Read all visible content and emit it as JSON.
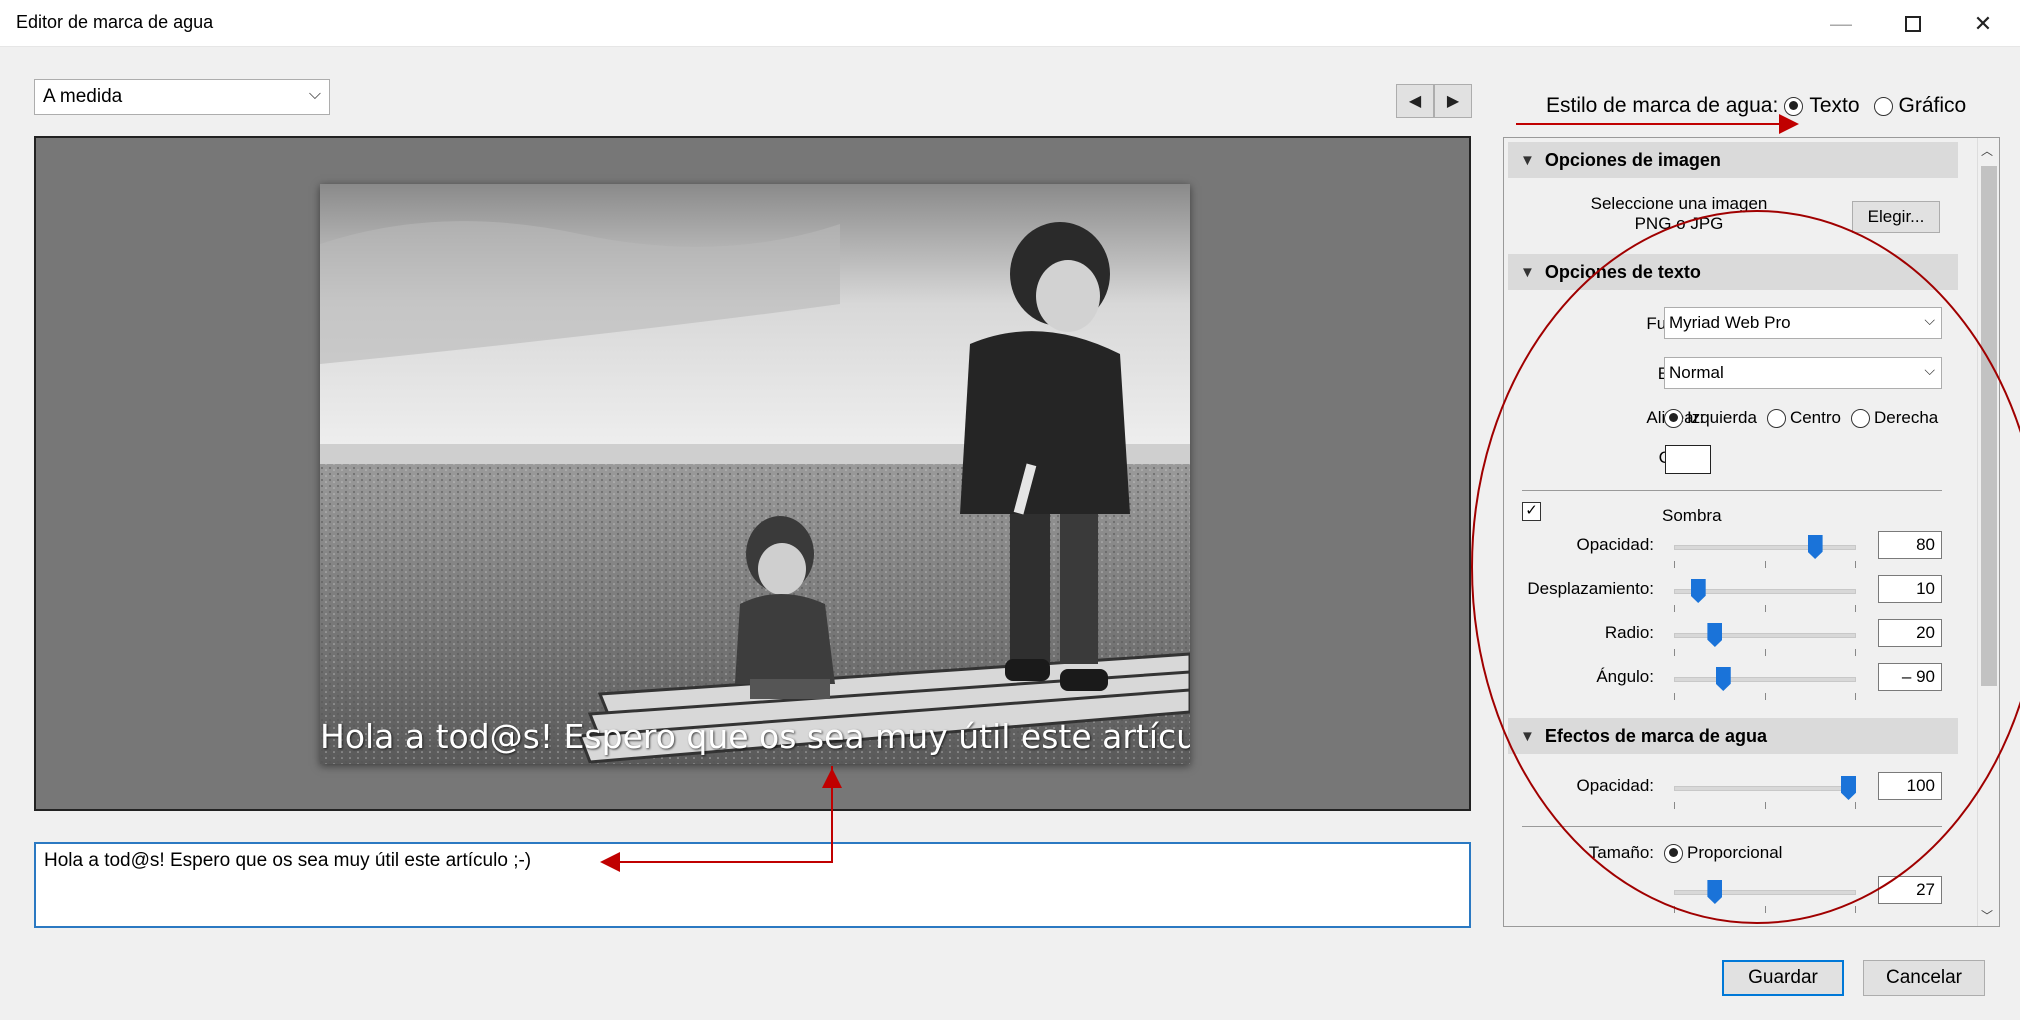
{
  "window": {
    "title": "Editor de marca de agua",
    "minimize_icon": "minimize-icon",
    "maximize_icon": "maximize-icon",
    "close_icon": "close-icon",
    "close_glyph": "✕",
    "minimize_glyph": "—"
  },
  "preset": {
    "value": "A medida",
    "chevron": "⌵"
  },
  "nav": {
    "prev_glyph": "◀",
    "next_glyph": "▶"
  },
  "preview": {
    "watermark_text": "Hola a tod@s! Espero que os sea muy útil este artículo ;-)"
  },
  "text_input": {
    "value": "Hola a tod@s! Espero que os sea muy útil este artículo ;-)"
  },
  "watermark_style": {
    "label": "Estilo de marca de agua:",
    "options": [
      "Texto",
      "Gráfico"
    ],
    "selected": "Texto"
  },
  "image_options": {
    "header": "Opciones de imagen",
    "select_label_line1": "Seleccione una imagen",
    "select_label_line2": "PNG o JPG",
    "choose_button": "Elegir..."
  },
  "text_options": {
    "header": "Opciones de texto",
    "font_label": "Fuente:",
    "font_value": "Myriad Web Pro",
    "style_label": "Estilo:",
    "style_value": "Normal",
    "align_label": "Alinear:",
    "align_options": [
      "Izquierda",
      "Centro",
      "Derecha"
    ],
    "align_selected": "Izquierda",
    "color_label": "Color:",
    "color_value": "#ffffff",
    "shadow_label": "Sombra",
    "shadow_checked": true,
    "check_glyph": "✓",
    "shadow_sliders": [
      {
        "label": "Opacidad:",
        "value": "80",
        "fraction": 0.8
      },
      {
        "label": "Desplazamiento:",
        "value": "10",
        "fraction": 0.1
      },
      {
        "label": "Radio:",
        "value": "20",
        "fraction": 0.2
      },
      {
        "label": "Ángulo:",
        "value": "– 90",
        "fraction": 0.25
      }
    ]
  },
  "effects": {
    "header": "Efectos de marca de agua",
    "opacity_label": "Opacidad:",
    "opacity_value": "100",
    "opacity_fraction": 1.0,
    "size_label": "Tamaño:",
    "size_option": "Proporcional",
    "size_value": "27",
    "size_fraction": 0.2
  },
  "buttons": {
    "save": "Guardar",
    "cancel": "Cancelar"
  },
  "colors": {
    "accent": "#1a73d9",
    "annotation": "#c00000"
  }
}
